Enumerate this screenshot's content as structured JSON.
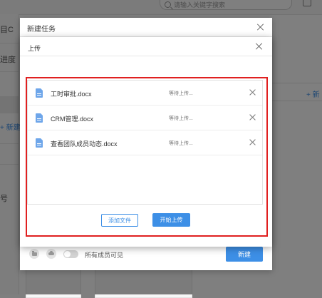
{
  "background": {
    "search_placeholder": "请输入关键字搜索",
    "sidebar_fragments": [
      "目C",
      "进度",
      "+ 新建任",
      "号"
    ],
    "right_link": "+ 新"
  },
  "outer_dialog": {
    "title": "新建任务",
    "footer": {
      "visibility_label": "所有成员可见",
      "create_button": "新建"
    }
  },
  "upload_dialog": {
    "title": "上传",
    "files": [
      {
        "name": "工时审批.docx",
        "status": "等待上传..."
      },
      {
        "name": "CRM管理.docx",
        "status": "等待上传..."
      },
      {
        "name": "查看团队成员动态.docx",
        "status": "等待上传..."
      }
    ],
    "add_file_button": "添加文件",
    "start_upload_button": "开始上传"
  },
  "colors": {
    "accent": "#3d8fe6",
    "highlight": "#e02020",
    "overlay": "rgba(0,0,0,0.5)"
  },
  "icons": [
    "search-icon",
    "camera-icon",
    "close-icon",
    "docx-file-icon",
    "folder-icon",
    "cloud-icon"
  ]
}
